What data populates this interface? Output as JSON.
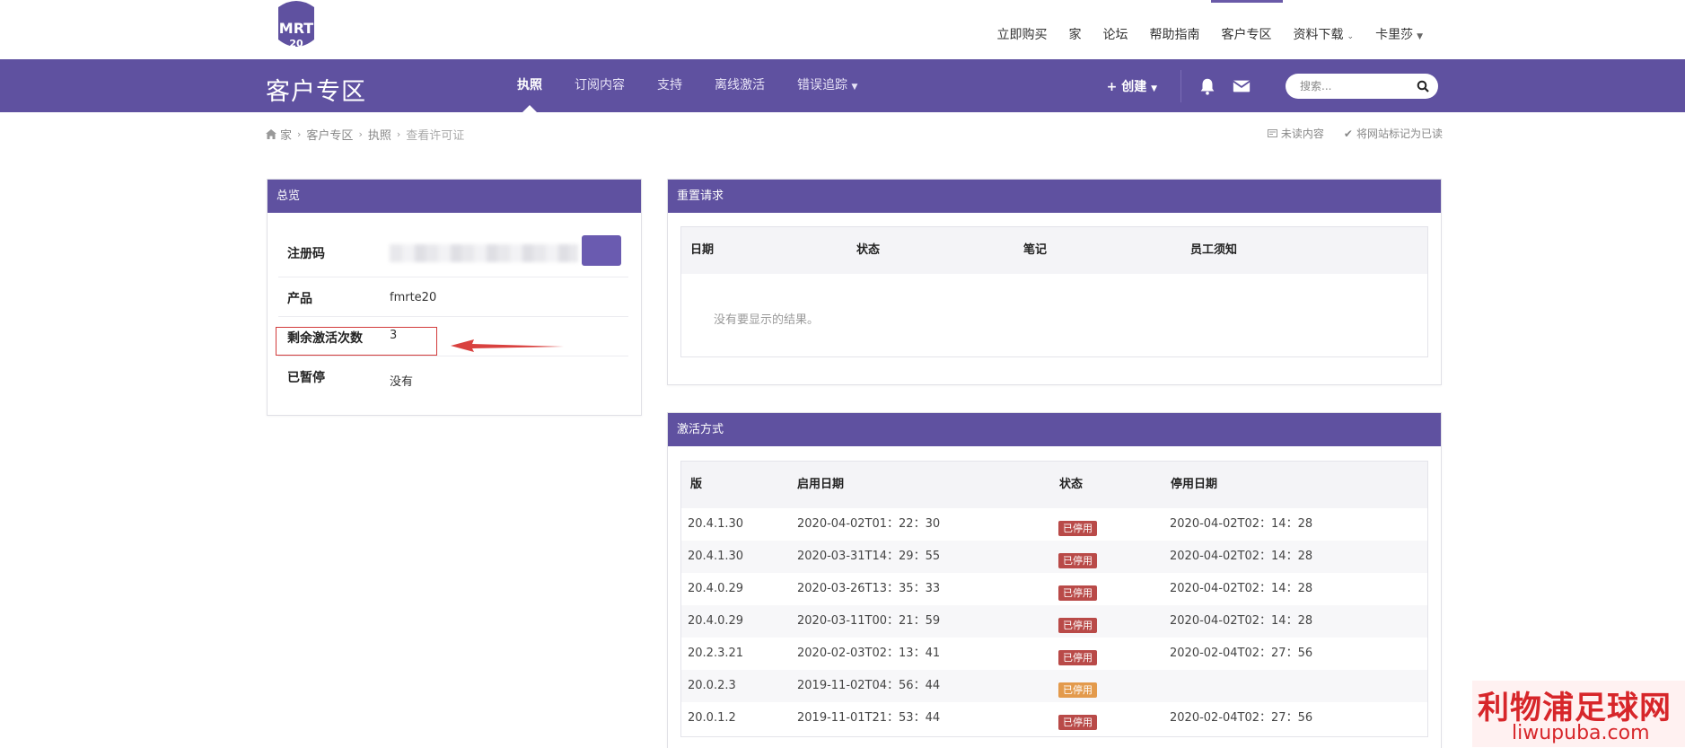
{
  "topnav": {
    "items": [
      "立即购买",
      "家",
      "论坛",
      "帮助指南",
      "客户专区",
      "资料下载",
      "卡里莎"
    ],
    "active_index": 4
  },
  "logo": {
    "text_top": "FMRTE",
    "text_bottom": "20",
    "accent_color": "#5f51a0"
  },
  "header": {
    "title": "客户专区",
    "tabs": [
      "执照",
      "订阅内容",
      "支持",
      "离线激活",
      "错误追踪"
    ],
    "active_tab": 0,
    "create_label": "创建",
    "search_placeholder": "搜索..."
  },
  "breadcrumb": {
    "items": [
      "家",
      "客户专区",
      "执照",
      "查看许可证"
    ]
  },
  "utility": {
    "unread": "未读内容",
    "mark_read": "将网站标记为已读"
  },
  "overview": {
    "title": "总览",
    "rows": [
      {
        "label": "注册码",
        "value": ""
      },
      {
        "label": "产品",
        "value": "fmrte20"
      },
      {
        "label": "剩余激活次数",
        "value": "3"
      },
      {
        "label": "已暂停",
        "value": "没有"
      }
    ]
  },
  "reset": {
    "title": "重置请求",
    "headers": [
      "日期",
      "状态",
      "笔记",
      "员工须知"
    ],
    "empty": "没有要显示的结果。"
  },
  "activations": {
    "title": "激活方式",
    "headers": [
      "版",
      "启用日期",
      "状态",
      "停用日期"
    ],
    "rows": [
      {
        "version": "20.4.1.30",
        "enabled": "2020-04-02T01：22：30",
        "status": "已停用",
        "disabled": "2020-04-02T02：14：28"
      },
      {
        "version": "20.4.1.30",
        "enabled": "2020-03-31T14：29：55",
        "status": "已停用",
        "disabled": "2020-04-02T02：14：28"
      },
      {
        "version": "20.4.0.29",
        "enabled": "2020-03-26T13：35：33",
        "status": "已停用",
        "disabled": "2020-04-02T02：14：28"
      },
      {
        "version": "20.4.0.29",
        "enabled": "2020-03-11T00：21：59",
        "status": "已停用",
        "disabled": "2020-04-02T02：14：28"
      },
      {
        "version": "20.2.3.21",
        "enabled": "2020-02-03T02：13：41",
        "status": "已停用",
        "disabled": "2020-02-04T02：27：56"
      },
      {
        "version": "20.0.2.3",
        "enabled": "2019-11-02T04：56：44",
        "status": "已停用",
        "disabled": ""
      },
      {
        "version": "20.0.1.2",
        "enabled": "2019-11-01T21：53：44",
        "status": "已停用",
        "disabled": "2020-02-04T02：27：56"
      }
    ],
    "status_colors": {
      "red": "#b94a48",
      "orange": "#e39a4c"
    }
  },
  "watermark": {
    "line1": "利物浦足球网",
    "line2": "liwupuba.com"
  },
  "colors": {
    "brand": "#5f51a0",
    "highlight": "#d23b3b"
  }
}
